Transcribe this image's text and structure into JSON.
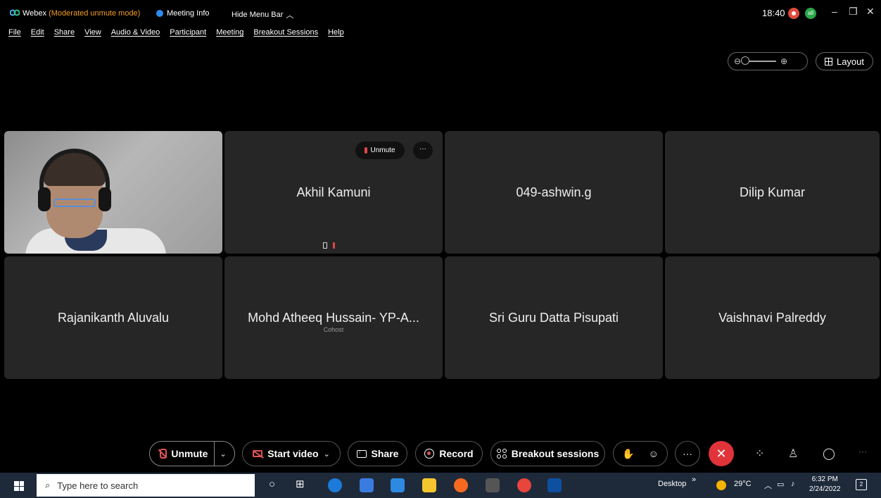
{
  "titlebar": {
    "app_name": "Webex",
    "mode": "(Moderated unmute mode)",
    "meeting_info": "Meeting Info",
    "hide_menu": "Hide Menu Bar",
    "clock": "18:40",
    "network_badge": "all"
  },
  "menu": [
    "File",
    "Edit",
    "Share",
    "View",
    "Audio & Video",
    "Participant",
    "Meeting",
    "Breakout Sessions",
    "Help"
  ],
  "layout_button": "Layout",
  "tiles": [
    {
      "name": ""
    },
    {
      "name": "Akhil Kamuni",
      "unmute_label": "Unmute",
      "more_label": "···"
    },
    {
      "name": "049-ashwin.g"
    },
    {
      "name": "Dilip Kumar"
    },
    {
      "name": "Rajanikanth Aluvalu"
    },
    {
      "name": "Mohd Atheeq Hussain- YP-A...",
      "role": "Cohost"
    },
    {
      "name": "Sri Guru Datta Pisupati"
    },
    {
      "name": "Vaishnavi Palreddy"
    }
  ],
  "controls": {
    "unmute": "Unmute",
    "start_video": "Start video",
    "share": "Share",
    "record": "Record",
    "breakout": "Breakout sessions",
    "end_color": "#e0333a"
  },
  "taskbar": {
    "search_placeholder": "Type here to search",
    "desktop_label": "Desktop",
    "weather": "29°C",
    "time": "6:32 PM",
    "date": "2/24/2022",
    "notif_count": "2"
  }
}
